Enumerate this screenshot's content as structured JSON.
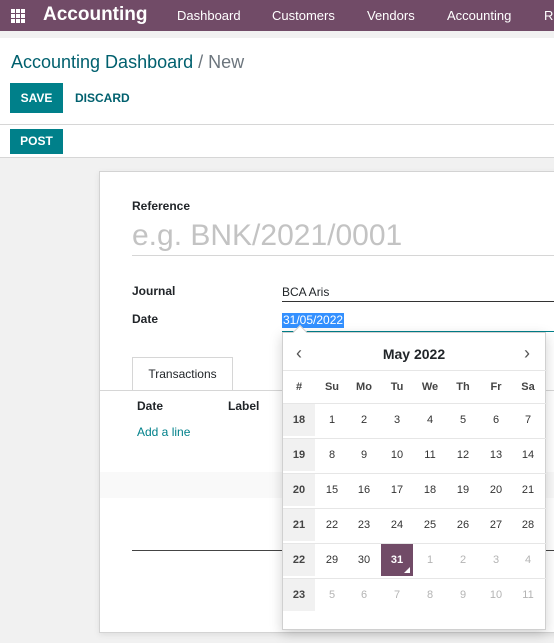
{
  "nav": {
    "brand": "Accounting",
    "items": [
      "Dashboard",
      "Customers",
      "Vendors",
      "Accounting",
      "R"
    ]
  },
  "breadcrumb": {
    "parent": "Accounting Dashboard",
    "separator": "/",
    "current": "New"
  },
  "buttons": {
    "save": "SAVE",
    "discard": "DISCARD",
    "post": "POST"
  },
  "form": {
    "reference_label": "Reference",
    "reference_placeholder": "e.g. BNK/2021/0001",
    "journal_label": "Journal",
    "journal_value": "BCA Aris",
    "date_label": "Date",
    "date_value": "31/05/2022"
  },
  "tabs": {
    "transactions": "Transactions"
  },
  "lines": {
    "columns": [
      "Date",
      "Label"
    ],
    "add_line": "Add a line"
  },
  "datepicker": {
    "prev_icon": "‹",
    "next_icon": "›",
    "month_title": "May 2022",
    "headers": [
      "#",
      "Su",
      "Mo",
      "Tu",
      "We",
      "Th",
      "Fr",
      "Sa"
    ],
    "weeks": [
      {
        "week": "18",
        "days": [
          "1",
          "2",
          "3",
          "4",
          "5",
          "6",
          "7"
        ]
      },
      {
        "week": "19",
        "days": [
          "8",
          "9",
          "10",
          "11",
          "12",
          "13",
          "14"
        ]
      },
      {
        "week": "20",
        "days": [
          "15",
          "16",
          "17",
          "18",
          "19",
          "20",
          "21"
        ]
      },
      {
        "week": "21",
        "days": [
          "22",
          "23",
          "24",
          "25",
          "26",
          "27",
          "28"
        ]
      },
      {
        "week": "22",
        "days": [
          "29",
          "30",
          "31",
          "1",
          "2",
          "3",
          "4"
        ]
      },
      {
        "week": "23",
        "days": [
          "5",
          "6",
          "7",
          "8",
          "9",
          "10",
          "11"
        ]
      }
    ],
    "selected_day": "31"
  },
  "colors": {
    "brand": "#714b67",
    "primary": "#00808a",
    "link": "#00606e",
    "selection": "#3390ff"
  }
}
